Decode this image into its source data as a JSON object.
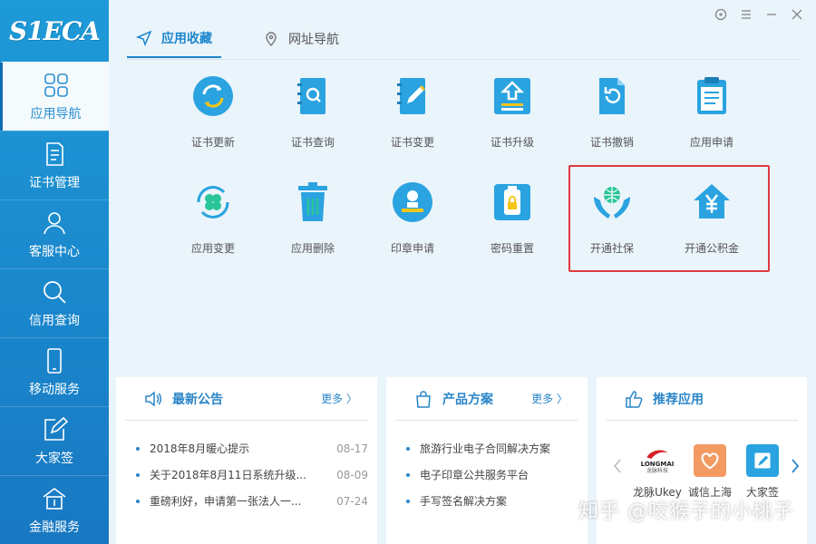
{
  "app": {
    "logo_text": "S1ECA"
  },
  "window_controls": [
    "help",
    "menu",
    "minimize",
    "close"
  ],
  "sidebar": {
    "items": [
      {
        "label": "应用导航",
        "icon": "grid-icon",
        "active": true
      },
      {
        "label": "证书管理",
        "icon": "document-icon"
      },
      {
        "label": "客服中心",
        "icon": "user-icon"
      },
      {
        "label": "信用查询",
        "icon": "search-icon"
      },
      {
        "label": "移动服务",
        "icon": "phone-icon"
      },
      {
        "label": "大家签",
        "icon": "edit-icon"
      },
      {
        "label": "金融服务",
        "icon": "bank-icon"
      }
    ]
  },
  "tabs": [
    {
      "label": "应用收藏",
      "icon": "send-icon",
      "active": true
    },
    {
      "label": "网址导航",
      "icon": "location-pin-icon"
    }
  ],
  "apps": [
    {
      "label": "证书更新",
      "icon": "refresh-icon"
    },
    {
      "label": "证书查询",
      "icon": "book-search-icon"
    },
    {
      "label": "证书变更",
      "icon": "book-edit-icon"
    },
    {
      "label": "证书升级",
      "icon": "upload-icon"
    },
    {
      "label": "证书撤销",
      "icon": "document-undo-icon"
    },
    {
      "label": "应用申请",
      "icon": "clipboard-icon"
    },
    {
      "label": "应用变更",
      "icon": "clover-refresh-icon"
    },
    {
      "label": "应用删除",
      "icon": "trash-icon"
    },
    {
      "label": "印章申请",
      "icon": "seal-icon"
    },
    {
      "label": "密码重置",
      "icon": "usb-key-icon"
    },
    {
      "label": "开通社保",
      "icon": "globe-hands-icon"
    },
    {
      "label": "开通公积金",
      "icon": "house-yen-icon"
    }
  ],
  "panels": {
    "announcements": {
      "title": "最新公告",
      "more": "更多 〉",
      "items": [
        {
          "text": "2018年8月暖心提示",
          "date": "08-17"
        },
        {
          "text": "关于2018年8月11日系统升级...",
          "date": "08-09"
        },
        {
          "text": "重磅利好，申请第一张法人一...",
          "date": "07-24"
        }
      ]
    },
    "solutions": {
      "title": "产品方案",
      "more": "更多 〉",
      "items": [
        {
          "text": "旅游行业电子合同解决方案"
        },
        {
          "text": "电子印章公共服务平台"
        },
        {
          "text": "手写签名解决方案"
        }
      ]
    },
    "recommended": {
      "title": "推荐应用",
      "items": [
        {
          "label": "龙脉Ukey",
          "logo_text": "LONGMAI",
          "logo_subtext": "龙脉科技"
        },
        {
          "label": "诚信上海"
        },
        {
          "label": "大家签"
        }
      ]
    }
  },
  "watermark": "知乎 @咬猴子的小桃子",
  "colors": {
    "sidebar": "#1e9ad8",
    "accent": "#1f86cc",
    "icon_blue": "#2aa3e0",
    "highlight": "#e0383e"
  }
}
